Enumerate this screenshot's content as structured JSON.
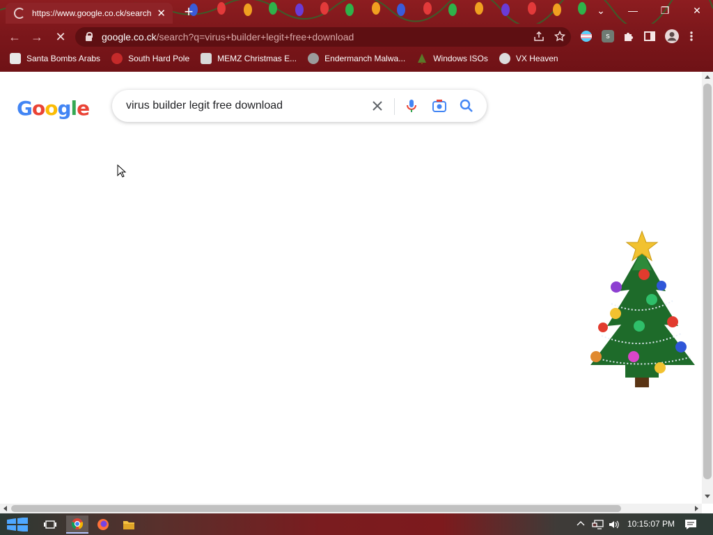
{
  "browser": {
    "tab": {
      "title": "https://www.google.co.ck/search?q=virus+builder+legit+free+download",
      "close_glyph": "✕"
    },
    "new_tab_glyph": "+",
    "window_controls": {
      "dropdown": "⌄",
      "minimize": "—",
      "restore": "❐",
      "close": "✕"
    },
    "nav": {
      "back": "←",
      "forward": "→",
      "stop": "✕"
    },
    "address": {
      "host": "google.co.ck",
      "path": "/search?q=virus+builder+legit+free+download"
    },
    "omnibox_icons": [
      "share-icon",
      "bookmark-star-icon"
    ],
    "extensions": [
      "flag-extension-icon",
      "s-extension-icon",
      "puzzle-icon",
      "side-panel-icon",
      "profile-icon",
      "menu-icon"
    ],
    "extension_s_label": "s",
    "bookmarks": [
      {
        "label": "Santa Bombs Arabs",
        "icon": "santa-icon",
        "color": "#e8e8e8"
      },
      {
        "label": "South Hard Pole",
        "icon": "snowflake-icon",
        "color": "#c52a2a"
      },
      {
        "label": "MEMZ Christmas E...",
        "icon": "memz-icon",
        "color": "#d9d9d9"
      },
      {
        "label": "Endermanch Malwa...",
        "icon": "raccoon-icon",
        "color": "#9c9c9c"
      },
      {
        "label": "Windows ISOs",
        "icon": "tree-icon",
        "color": "#5a7a2a"
      },
      {
        "label": "VX Heaven",
        "icon": "vx-icon",
        "color": "#dcdcdc"
      }
    ]
  },
  "google": {
    "logo_letters": [
      "G",
      "o",
      "o",
      "g",
      "l",
      "e"
    ],
    "logo_colors": [
      "#4285f4",
      "#ea4335",
      "#fbbc05",
      "#4285f4",
      "#34a853",
      "#ea4335"
    ],
    "query": "virus builder legit free download",
    "search_icons": [
      "clear-icon",
      "microphone-icon",
      "camera-icon",
      "search-icon"
    ]
  },
  "taskbar": {
    "apps": [
      "start-icon",
      "task-view-icon",
      "chrome-icon",
      "firefox-icon",
      "file-explorer-icon"
    ],
    "tray_icons": [
      "chevron-up-icon",
      "network-icon",
      "volume-icon",
      "notification-icon"
    ],
    "clock": "10:15:07 PM"
  },
  "colors": {
    "theme_red": "#7c171b",
    "google_blue": "#4285f4",
    "google_red": "#ea4335"
  }
}
